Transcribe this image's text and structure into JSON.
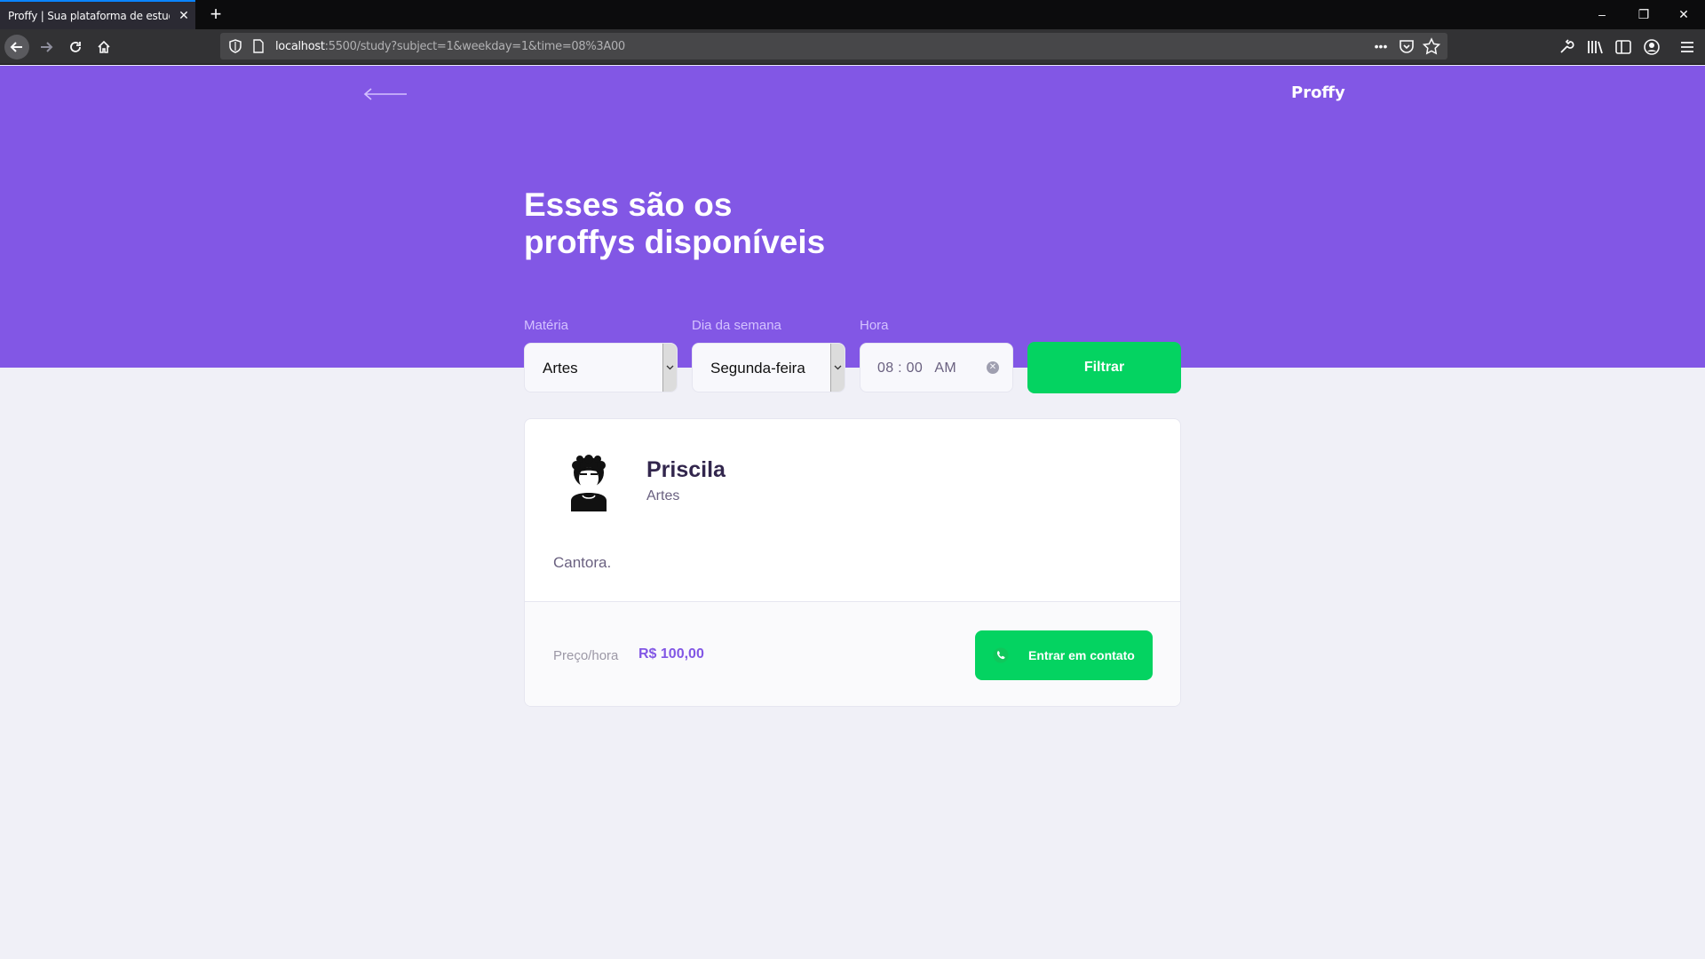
{
  "browser": {
    "tab_title": "Proffy | Sua plataforma de estudos",
    "tab_close": "✕",
    "new_tab": "+",
    "url_host": "localhost",
    "url_rest": ":5500/study?subject=1&weekday=1&time=08%3A00",
    "url_more": "•••",
    "window_minimize": "–",
    "window_restore": "❐",
    "window_close": "✕"
  },
  "header": {
    "brand": "Proffy",
    "title_line1": "Esses são os",
    "title_line2": "proffys disponíveis"
  },
  "filters": {
    "subject_label": "Matéria",
    "subject_value": "Artes",
    "weekday_label": "Dia da semana",
    "weekday_value": "Segunda-feira",
    "time_label": "Hora",
    "time_value": "08 : 00   AM",
    "submit_label": "Filtrar"
  },
  "teachers": [
    {
      "name": "Priscila",
      "subject": "Artes",
      "bio": "Cantora.",
      "price_label": "Preço/hora",
      "price_value": "R$ 100,00",
      "contact_label": "Entrar em contato"
    }
  ],
  "colors": {
    "primary": "#8257e5",
    "secondary": "#04d361",
    "background": "#f0f0f7",
    "title_in_primary": "#ffffff",
    "text_title": "#32264d",
    "text_base": "#6a6180"
  },
  "icons": {
    "back": "back-arrow-icon",
    "avatar": "avatar-icon",
    "contact": "whatsapp-icon",
    "reload": "reload-icon",
    "home": "home-icon"
  }
}
